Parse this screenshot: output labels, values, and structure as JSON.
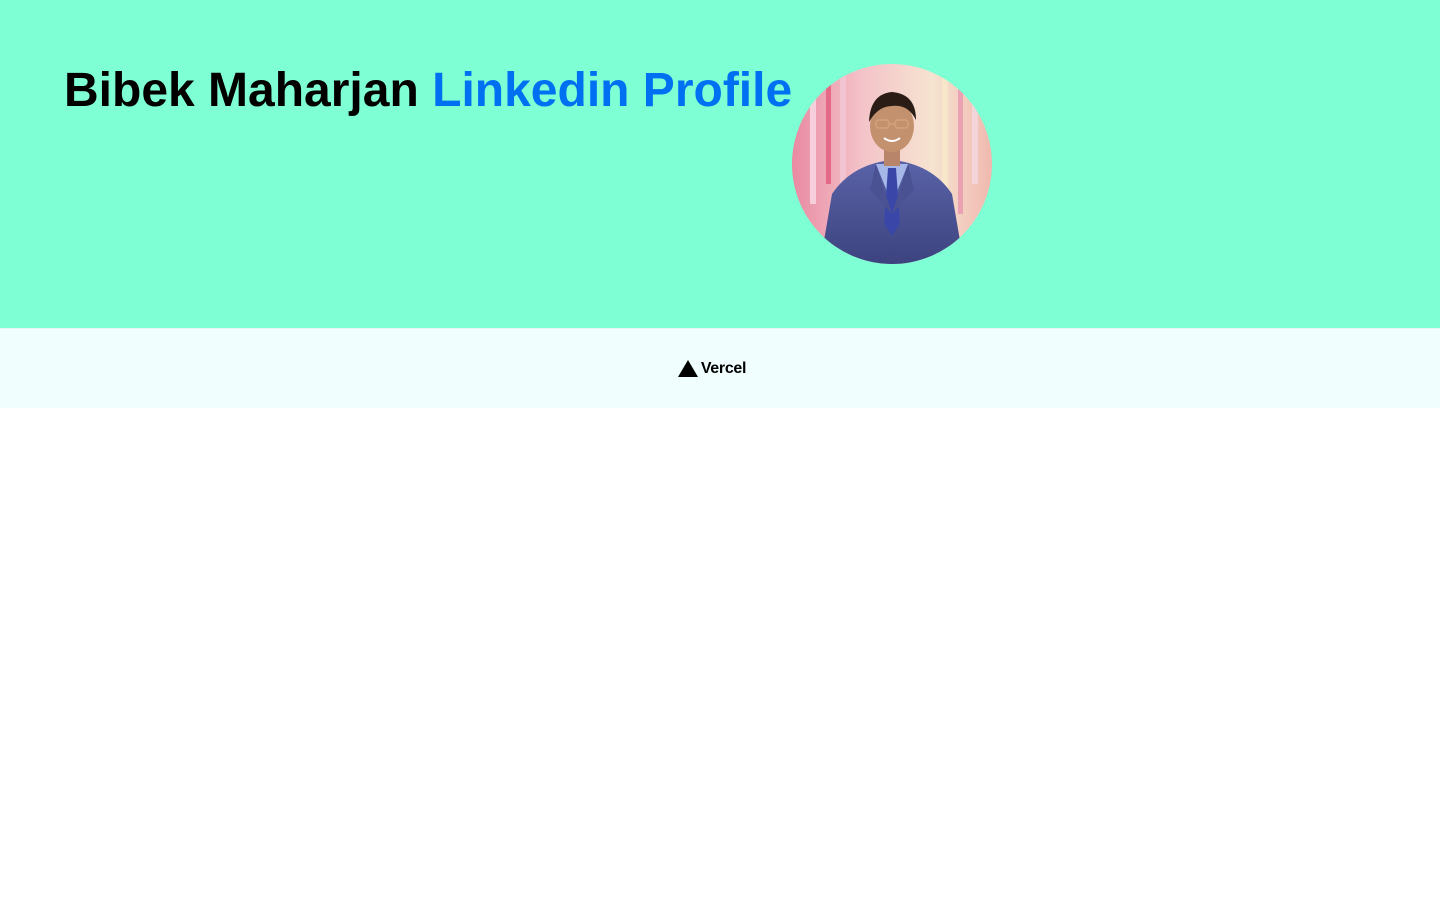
{
  "hero": {
    "name": "Bibek Maharjan",
    "link_label": "Linkedin Profile",
    "avatar_alt": "profile-photo"
  },
  "footer": {
    "brand": "Vercel",
    "logo_icon": "vercel-triangle-icon"
  },
  "colors": {
    "hero_bg": "#7fffd4",
    "link": "#0070f3",
    "footer_bg": "#f0fffe",
    "text": "#000000"
  }
}
